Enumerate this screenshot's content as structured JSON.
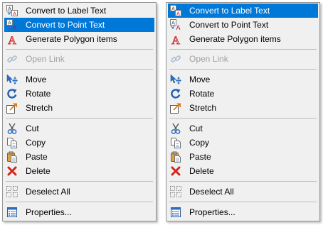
{
  "menus": [
    {
      "highlighted_item": "Convert to Point Text",
      "items": [
        {
          "label": "Convert to Label Text",
          "icon": "convert-label-text-icon"
        },
        {
          "label": "Convert to Point Text",
          "icon": "convert-point-text-icon"
        },
        {
          "label": "Generate Polygon items",
          "icon": "generate-polygon-icon"
        },
        {
          "label": "Open Link",
          "icon": "open-link-icon",
          "disabled": true
        },
        {
          "label": "Move",
          "icon": "move-icon"
        },
        {
          "label": "Rotate",
          "icon": "rotate-icon"
        },
        {
          "label": "Stretch",
          "icon": "stretch-icon"
        },
        {
          "label": "Cut",
          "icon": "cut-icon"
        },
        {
          "label": "Copy",
          "icon": "copy-icon"
        },
        {
          "label": "Paste",
          "icon": "paste-icon"
        },
        {
          "label": "Delete",
          "icon": "delete-icon"
        },
        {
          "label": "Deselect All",
          "icon": "deselect-all-icon"
        },
        {
          "label": "Properties...",
          "icon": "properties-icon"
        }
      ]
    },
    {
      "highlighted_item": "Convert to Label Text",
      "items": [
        {
          "label": "Convert to Label Text",
          "icon": "convert-label-text-icon"
        },
        {
          "label": "Convert to Point Text",
          "icon": "convert-point-text-icon"
        },
        {
          "label": "Generate Polygon items",
          "icon": "generate-polygon-icon"
        },
        {
          "label": "Open Link",
          "icon": "open-link-icon",
          "disabled": true
        },
        {
          "label": "Move",
          "icon": "move-icon"
        },
        {
          "label": "Rotate",
          "icon": "rotate-icon"
        },
        {
          "label": "Stretch",
          "icon": "stretch-icon"
        },
        {
          "label": "Cut",
          "icon": "cut-icon"
        },
        {
          "label": "Copy",
          "icon": "copy-icon"
        },
        {
          "label": "Paste",
          "icon": "paste-icon"
        },
        {
          "label": "Delete",
          "icon": "delete-icon"
        },
        {
          "label": "Deselect All",
          "icon": "deselect-all-icon"
        },
        {
          "label": "Properties...",
          "icon": "properties-icon"
        }
      ]
    }
  ],
  "colors": {
    "highlight": "#0078d7",
    "highlight_text": "#ffffff",
    "menu_background": "#f0f0f0",
    "disabled_text": "#a0a0a0",
    "separator": "#bdbdbd"
  }
}
